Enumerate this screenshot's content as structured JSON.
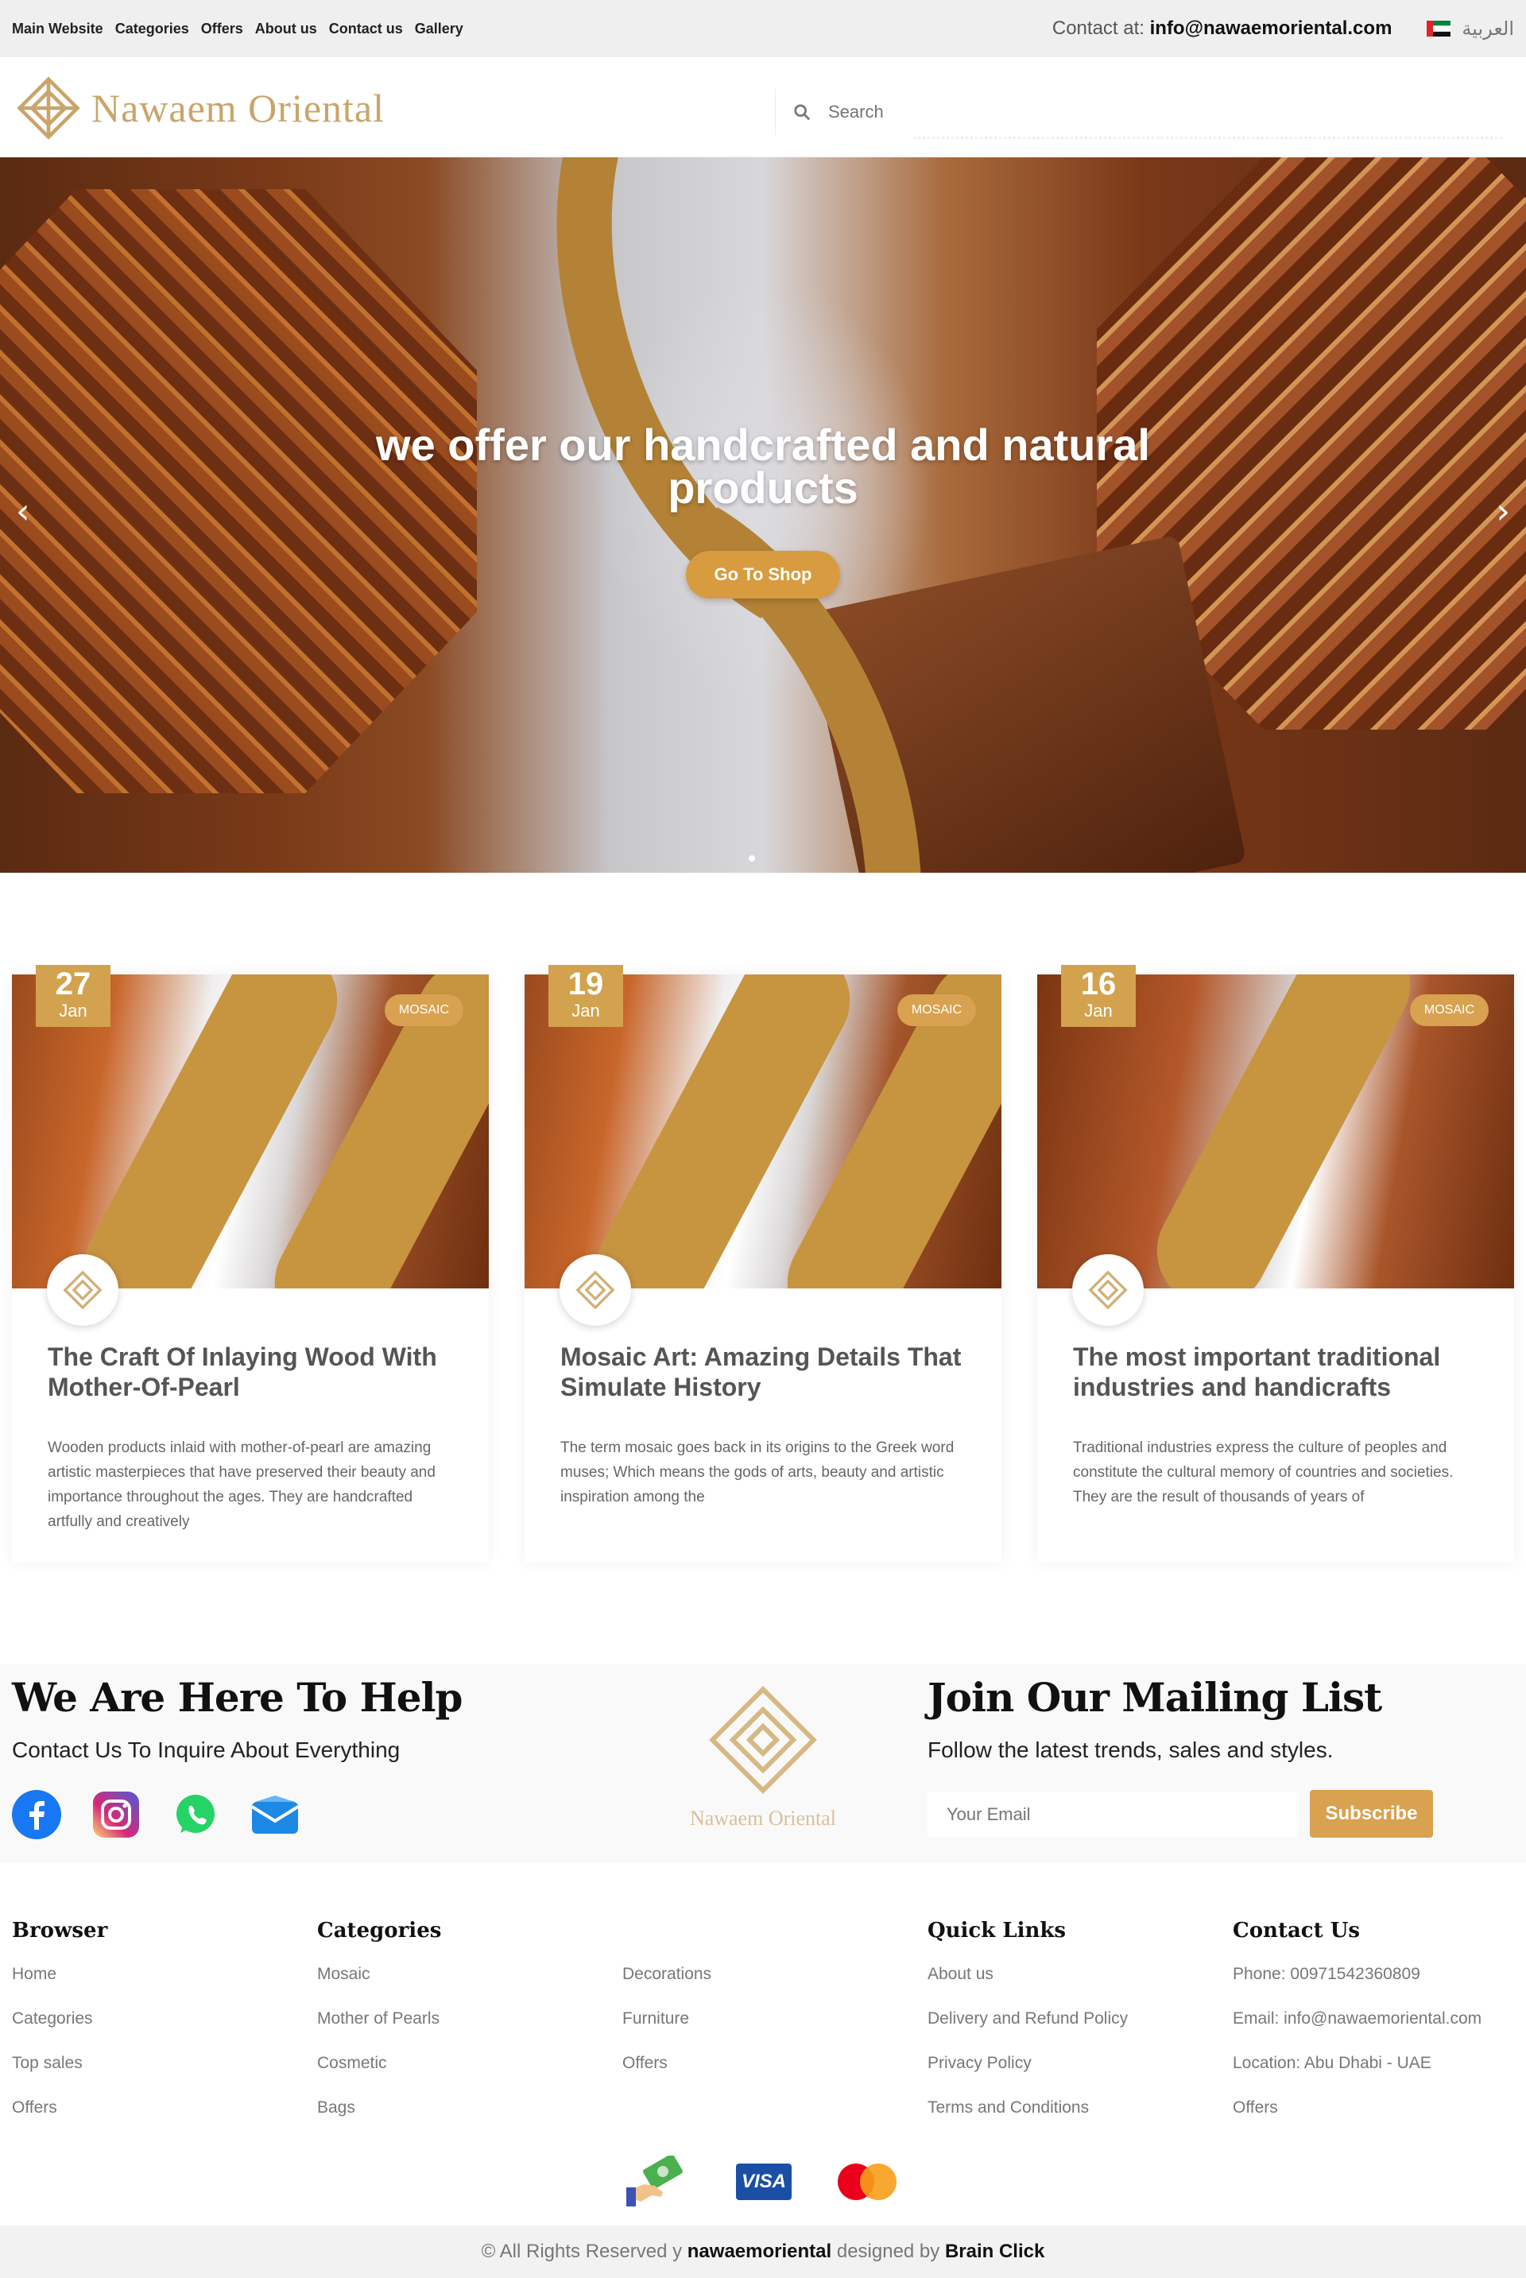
{
  "topbar": {
    "nav": [
      "Main Website",
      "Categories",
      "Offers",
      "About us",
      "Contact us",
      "Gallery"
    ],
    "contact_label": "Contact at: ",
    "contact_email": "info@nawaemoriental.com",
    "language": "العربية"
  },
  "header": {
    "logo_text": "Nawaem Oriental",
    "search_placeholder": "Search"
  },
  "hero": {
    "title_line1": "we offer our handcrafted and natural",
    "title_line2": "products",
    "button": "Go To Shop",
    "prev_icon": "chevron-left-icon",
    "next_icon": "chevron-right-icon"
  },
  "posts": [
    {
      "day": "27",
      "month": "Jan",
      "tag": "MOSAIC",
      "title": "The Craft Of Inlaying Wood With Mother-Of-Pearl",
      "excerpt": "Wooden products inlaid with mother-of-pearl are amazing artistic masterpieces that have preserved their beauty and importance throughout the ages. They are handcrafted artfully and creatively"
    },
    {
      "day": "19",
      "month": "Jan",
      "tag": "MOSAIC",
      "title": "Mosaic Art: Amazing Details That Simulate History",
      "excerpt": "The term mosaic goes back in its origins to the Greek word muses; Which means the gods of arts, beauty and artistic inspiration among the"
    },
    {
      "day": "16",
      "month": "Jan",
      "tag": "MOSAIC",
      "title": "The most important traditional industries and handicrafts",
      "excerpt": "Traditional industries express the culture of peoples and constitute the cultural memory of countries and societies. They are the result of thousands of years of"
    }
  ],
  "help": {
    "title": "We Are Here To Help",
    "subtitle": "Contact Us To Inquire About Everything",
    "logo_text": "Nawaem Oriental",
    "socials": [
      "facebook-icon",
      "instagram-icon",
      "whatsapp-icon",
      "email-icon"
    ]
  },
  "mailing": {
    "title": "Join Our Mailing List",
    "subtitle": "Follow the latest trends, sales and styles.",
    "placeholder": "Your Email",
    "button": "Subscribe"
  },
  "footer": {
    "browser": {
      "title": "Browser",
      "links": [
        "Home",
        "Categories",
        "Top sales",
        "Offers"
      ]
    },
    "categories": {
      "title": "Categories",
      "links": [
        "Mosaic",
        "Mother of Pearls",
        "Cosmetic",
        "Bags"
      ],
      "links2": [
        "Decorations",
        "Furniture",
        "Offers"
      ]
    },
    "quick": {
      "title": "Quick Links",
      "links": [
        "About us",
        "Delivery and Refund Policy",
        "Privacy Policy",
        "Terms and Conditions"
      ]
    },
    "contact": {
      "title": "Contact Us",
      "links": [
        "Phone: 00971542360809",
        "Email: info@nawaemoriental.com",
        "Location: Abu Dhabi - UAE",
        "Offers"
      ]
    }
  },
  "payments": {
    "visa": "VISA"
  },
  "copyright": {
    "prefix": "© All Rights Reserved y ",
    "brand": "nawaemoriental",
    "middle": " designed by ",
    "designer": "Brain Click"
  },
  "colors": {
    "accent": "#d8a250",
    "logo": "#c9a56a"
  }
}
